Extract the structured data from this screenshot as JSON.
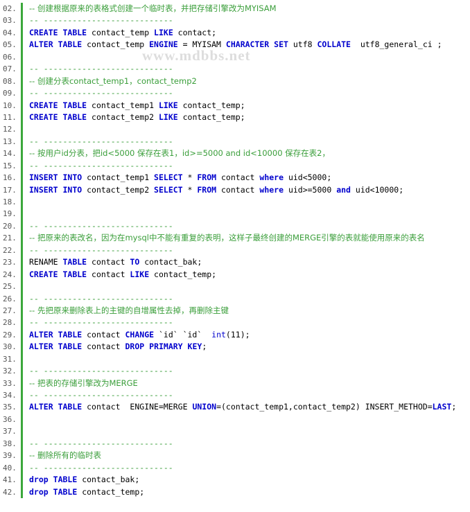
{
  "document": {
    "watermark": "www.mdbbs.net",
    "language": "sql",
    "accent_color": "#3ba83b",
    "keyword_color": "#0000cd",
    "comment_color": "#3a9e3a",
    "first_line_number": 2,
    "lines": [
      {
        "n": "02.",
        "segments": [
          {
            "t": "-- 创建根据原来的表格式创建一个临时表，并把存储引擎改为MYISAM",
            "c": "cmt"
          }
        ]
      },
      {
        "n": "03.",
        "segments": [
          {
            "t": "-- ---------------------------",
            "c": "cmt"
          }
        ]
      },
      {
        "n": "04.",
        "segments": [
          {
            "t": "CREATE",
            "c": "kw"
          },
          {
            "t": " ",
            "c": "plain"
          },
          {
            "t": "TABLE",
            "c": "kw"
          },
          {
            "t": " contact_temp ",
            "c": "plain"
          },
          {
            "t": "LIKE",
            "c": "kw"
          },
          {
            "t": " contact;",
            "c": "plain"
          }
        ]
      },
      {
        "n": "05.",
        "segments": [
          {
            "t": "ALTER",
            "c": "kw"
          },
          {
            "t": " ",
            "c": "plain"
          },
          {
            "t": "TABLE",
            "c": "kw"
          },
          {
            "t": " contact_temp ",
            "c": "plain"
          },
          {
            "t": "ENGINE",
            "c": "kw"
          },
          {
            "t": " = MYISAM ",
            "c": "plain"
          },
          {
            "t": "CHARACTER",
            "c": "kw"
          },
          {
            "t": " ",
            "c": "plain"
          },
          {
            "t": "SET",
            "c": "kw"
          },
          {
            "t": " utf8 ",
            "c": "plain"
          },
          {
            "t": "COLLATE",
            "c": "kw"
          },
          {
            "t": "  utf8_general_ci ;",
            "c": "plain"
          }
        ]
      },
      {
        "n": "06.",
        "segments": []
      },
      {
        "n": "07.",
        "segments": [
          {
            "t": "-- ---------------------------",
            "c": "cmt"
          }
        ]
      },
      {
        "n": "08.",
        "segments": [
          {
            "t": "-- 创建分表contact_temp1，contact_temp2",
            "c": "cmt"
          }
        ]
      },
      {
        "n": "09.",
        "segments": [
          {
            "t": "-- ---------------------------",
            "c": "cmt"
          }
        ]
      },
      {
        "n": "10.",
        "segments": [
          {
            "t": "CREATE",
            "c": "kw"
          },
          {
            "t": " ",
            "c": "plain"
          },
          {
            "t": "TABLE",
            "c": "kw"
          },
          {
            "t": " contact_temp1 ",
            "c": "plain"
          },
          {
            "t": "LIKE",
            "c": "kw"
          },
          {
            "t": " contact_temp;",
            "c": "plain"
          }
        ]
      },
      {
        "n": "11.",
        "segments": [
          {
            "t": "CREATE",
            "c": "kw"
          },
          {
            "t": " ",
            "c": "plain"
          },
          {
            "t": "TABLE",
            "c": "kw"
          },
          {
            "t": " contact_temp2 ",
            "c": "plain"
          },
          {
            "t": "LIKE",
            "c": "kw"
          },
          {
            "t": " contact_temp;",
            "c": "plain"
          }
        ]
      },
      {
        "n": "12.",
        "segments": []
      },
      {
        "n": "13.",
        "segments": [
          {
            "t": "-- ---------------------------",
            "c": "cmt"
          }
        ]
      },
      {
        "n": "14.",
        "segments": [
          {
            "t": "-- 按用户id分表，把id<5000 保存在表1，id>=5000 and id<10000 保存在表2，",
            "c": "cmt"
          }
        ]
      },
      {
        "n": "15.",
        "segments": [
          {
            "t": "-- ---------------------------",
            "c": "cmt"
          }
        ]
      },
      {
        "n": "16.",
        "segments": [
          {
            "t": "INSERT",
            "c": "kw"
          },
          {
            "t": " ",
            "c": "plain"
          },
          {
            "t": "INTO",
            "c": "kw"
          },
          {
            "t": " contact_temp1 ",
            "c": "plain"
          },
          {
            "t": "SELECT",
            "c": "kw"
          },
          {
            "t": " * ",
            "c": "plain"
          },
          {
            "t": "FROM",
            "c": "kw"
          },
          {
            "t": " contact ",
            "c": "plain"
          },
          {
            "t": "where",
            "c": "kw"
          },
          {
            "t": " uid<5000;",
            "c": "plain"
          }
        ]
      },
      {
        "n": "17.",
        "segments": [
          {
            "t": "INSERT",
            "c": "kw"
          },
          {
            "t": " ",
            "c": "plain"
          },
          {
            "t": "INTO",
            "c": "kw"
          },
          {
            "t": " contact_temp2 ",
            "c": "plain"
          },
          {
            "t": "SELECT",
            "c": "kw"
          },
          {
            "t": " * ",
            "c": "plain"
          },
          {
            "t": "FROM",
            "c": "kw"
          },
          {
            "t": " contact ",
            "c": "plain"
          },
          {
            "t": "where",
            "c": "kw"
          },
          {
            "t": " uid>=5000 ",
            "c": "plain"
          },
          {
            "t": "and",
            "c": "kw"
          },
          {
            "t": " uid<10000;",
            "c": "plain"
          }
        ]
      },
      {
        "n": "18.",
        "segments": []
      },
      {
        "n": "19.",
        "segments": []
      },
      {
        "n": "20.",
        "segments": [
          {
            "t": "-- ---------------------------",
            "c": "cmt"
          }
        ]
      },
      {
        "n": "21.",
        "segments": [
          {
            "t": "-- 把原来的表改名，因为在mysql中不能有重复的表明，这样子最终创建的MERGE引擎的表就能使用原来的表名",
            "c": "cmt"
          }
        ]
      },
      {
        "n": "22.",
        "segments": [
          {
            "t": "-- ---------------------------",
            "c": "cmt"
          }
        ]
      },
      {
        "n": "23.",
        "segments": [
          {
            "t": "RENAME ",
            "c": "plain"
          },
          {
            "t": "TABLE",
            "c": "kw"
          },
          {
            "t": " contact ",
            "c": "plain"
          },
          {
            "t": "TO",
            "c": "kw"
          },
          {
            "t": " contact_bak;",
            "c": "plain"
          }
        ]
      },
      {
        "n": "24.",
        "segments": [
          {
            "t": "CREATE",
            "c": "kw"
          },
          {
            "t": " ",
            "c": "plain"
          },
          {
            "t": "TABLE",
            "c": "kw"
          },
          {
            "t": " contact ",
            "c": "plain"
          },
          {
            "t": "LIKE",
            "c": "kw"
          },
          {
            "t": " contact_temp;",
            "c": "plain"
          }
        ]
      },
      {
        "n": "25.",
        "segments": []
      },
      {
        "n": "26.",
        "segments": [
          {
            "t": "-- ---------------------------",
            "c": "cmt"
          }
        ]
      },
      {
        "n": "27.",
        "segments": [
          {
            "t": "-- 先把原来删除表上的主键的自增属性去掉，再删除主键",
            "c": "cmt"
          }
        ]
      },
      {
        "n": "28.",
        "segments": [
          {
            "t": "-- ---------------------------",
            "c": "cmt"
          }
        ]
      },
      {
        "n": "29.",
        "segments": [
          {
            "t": "ALTER",
            "c": "kw"
          },
          {
            "t": " ",
            "c": "plain"
          },
          {
            "t": "TABLE",
            "c": "kw"
          },
          {
            "t": " contact ",
            "c": "plain"
          },
          {
            "t": "CHANGE",
            "c": "kw"
          },
          {
            "t": " `id` `id`  ",
            "c": "plain"
          },
          {
            "t": "int",
            "c": "typ"
          },
          {
            "t": "(11);",
            "c": "plain"
          }
        ]
      },
      {
        "n": "30.",
        "segments": [
          {
            "t": "ALTER",
            "c": "kw"
          },
          {
            "t": " ",
            "c": "plain"
          },
          {
            "t": "TABLE",
            "c": "kw"
          },
          {
            "t": " contact ",
            "c": "plain"
          },
          {
            "t": "DROP",
            "c": "kw"
          },
          {
            "t": " ",
            "c": "plain"
          },
          {
            "t": "PRIMARY",
            "c": "kw"
          },
          {
            "t": " ",
            "c": "plain"
          },
          {
            "t": "KEY",
            "c": "kw"
          },
          {
            "t": ";",
            "c": "plain"
          }
        ]
      },
      {
        "n": "31.",
        "segments": []
      },
      {
        "n": "32.",
        "segments": [
          {
            "t": "-- ---------------------------",
            "c": "cmt"
          }
        ]
      },
      {
        "n": "33.",
        "segments": [
          {
            "t": "-- 把表的存储引擎改为MERGE",
            "c": "cmt"
          }
        ]
      },
      {
        "n": "34.",
        "segments": [
          {
            "t": "-- ---------------------------",
            "c": "cmt"
          }
        ]
      },
      {
        "n": "35.",
        "segments": [
          {
            "t": "ALTER",
            "c": "kw"
          },
          {
            "t": " ",
            "c": "plain"
          },
          {
            "t": "TABLE",
            "c": "kw"
          },
          {
            "t": " contact  ENGINE=MERGE ",
            "c": "plain"
          },
          {
            "t": "UNION",
            "c": "kw"
          },
          {
            "t": "=(contact_temp1,contact_temp2) INSERT_METHOD=",
            "c": "plain"
          },
          {
            "t": "LAST",
            "c": "kw"
          },
          {
            "t": ";",
            "c": "plain"
          }
        ]
      },
      {
        "n": "36.",
        "segments": []
      },
      {
        "n": "37.",
        "segments": []
      },
      {
        "n": "38.",
        "segments": [
          {
            "t": "-- ---------------------------",
            "c": "cmt"
          }
        ]
      },
      {
        "n": "39.",
        "segments": [
          {
            "t": "-- 删除所有的临时表",
            "c": "cmt"
          }
        ]
      },
      {
        "n": "40.",
        "segments": [
          {
            "t": "-- ---------------------------",
            "c": "cmt"
          }
        ]
      },
      {
        "n": "41.",
        "segments": [
          {
            "t": "drop",
            "c": "kw"
          },
          {
            "t": " ",
            "c": "plain"
          },
          {
            "t": "TABLE",
            "c": "kw"
          },
          {
            "t": " contact_bak;",
            "c": "plain"
          }
        ]
      },
      {
        "n": "42.",
        "segments": [
          {
            "t": "drop",
            "c": "kw"
          },
          {
            "t": " ",
            "c": "plain"
          },
          {
            "t": "TABLE",
            "c": "kw"
          },
          {
            "t": " contact_temp;",
            "c": "plain"
          }
        ]
      }
    ]
  }
}
